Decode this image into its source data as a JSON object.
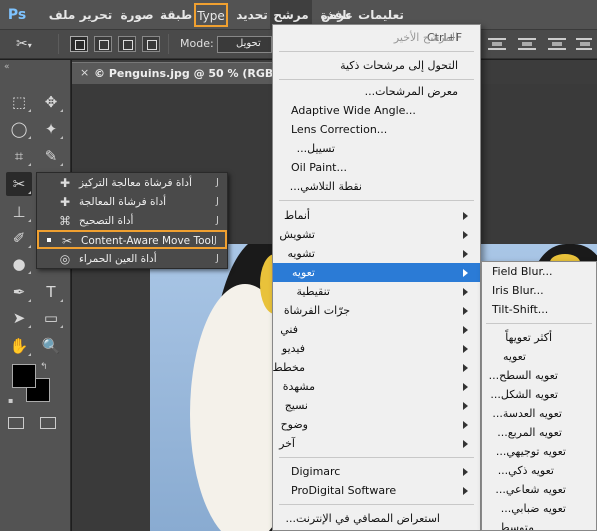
{
  "app": {
    "logo": "Ps"
  },
  "menubar": {
    "items": [
      "تعليمات",
      "نافذة",
      "عرض",
      "مرشح",
      "تحديد",
      "Type",
      "طبقة",
      "صورة",
      "تحرير",
      "ملف"
    ]
  },
  "options": {
    "mode_label": "Mode:",
    "mode_value": "تحويل"
  },
  "document": {
    "tab_close": "×",
    "tab_title": "© Penguins.jpg @ 50 % (RGB/8#)"
  },
  "tool_flyout": {
    "items": [
      {
        "label": "أداة فرشاة معالجة التركيز",
        "key": "J",
        "icon": "spot-healing-brush-icon"
      },
      {
        "label": "أداة فرشاة المعالجة",
        "key": "J",
        "icon": "healing-brush-icon"
      },
      {
        "label": "أداة التصحيح",
        "key": "J",
        "icon": "patch-icon"
      },
      {
        "label": "Content-Aware Move Tool",
        "key": "J",
        "icon": "content-aware-move-icon",
        "selected": true
      },
      {
        "label": "أداة العين الحمراء",
        "key": "J",
        "icon": "red-eye-icon"
      }
    ]
  },
  "filter_menu": {
    "last_filter": {
      "label": "المرشح الأخير",
      "shortcut": "Ctrl+F"
    },
    "smart": "التحول إلى مرشحات ذكية",
    "group1": [
      "معرض المرشحات...",
      "Adaptive Wide Angle...",
      "Lens Correction...",
      "تسييل...",
      "Oil Paint...",
      "نقطة التلاشي..."
    ],
    "group2": [
      "أنماط",
      "تشويش",
      "تشويه",
      "تعويه",
      "تنقيطية",
      "جرّات الفرشاة",
      "فني",
      "فيديو",
      "مخطط",
      "مشهدة",
      "نسيج",
      "وضوح",
      "آخر"
    ],
    "active_item": "تعويه",
    "group3": [
      "Digimarc",
      "ProDigital Software"
    ],
    "browse": "استعراض المصافي في الإنترنت..."
  },
  "blur_menu": {
    "group1": [
      "Field Blur...",
      "Iris Blur...",
      "Tilt-Shift..."
    ],
    "group2": [
      "أكثر تعويهاً",
      "تعويه",
      "تعويه السطح...",
      "تعويه الشكل...",
      "تعويه العدسة...",
      "تعويه المربع...",
      "تعويه توجيهي...",
      "تعويه ذكي...",
      "تعويه شعاعي...",
      "تعويه ضبابي...",
      "متوسط"
    ]
  }
}
